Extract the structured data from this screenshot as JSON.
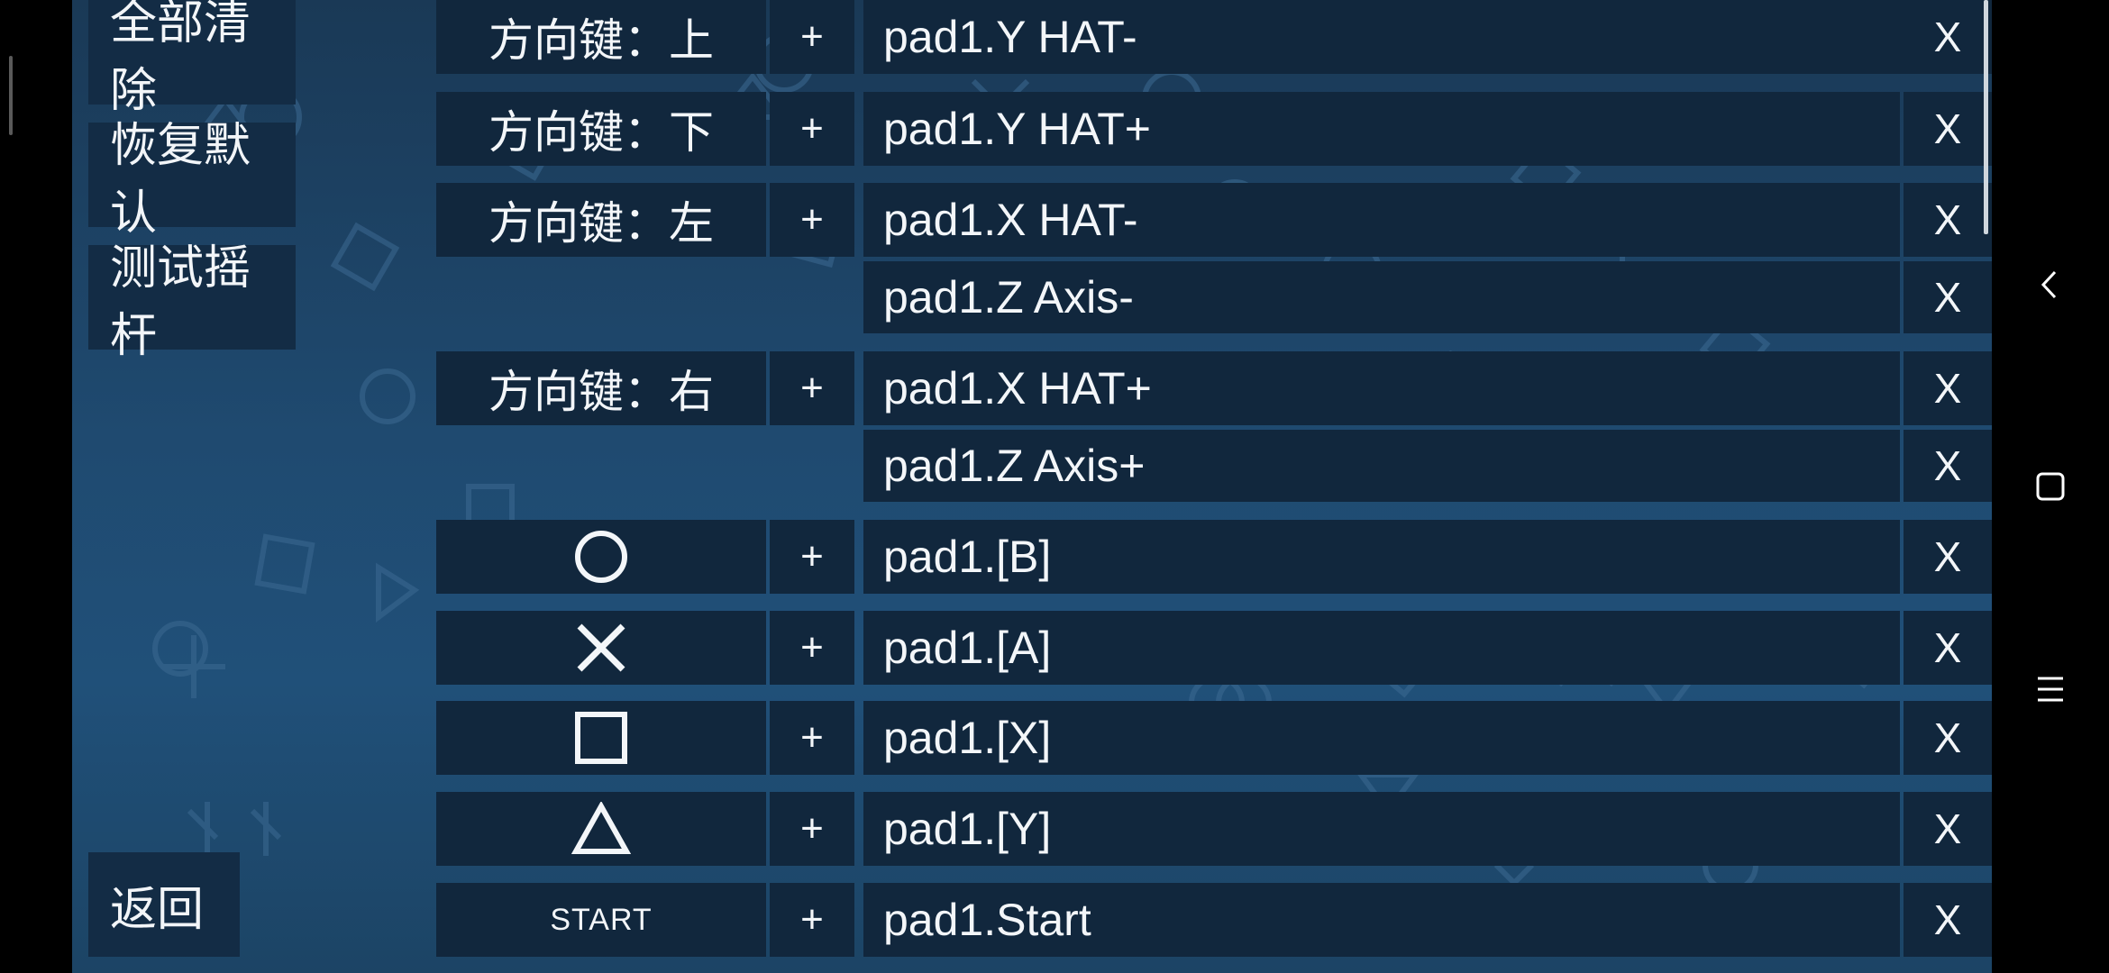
{
  "sidebar": {
    "clear_all": "全部清除",
    "restore_default": "恢复默认",
    "test_joystick": "测试摇杆",
    "back": "返回"
  },
  "mappings": [
    {
      "key": "方向键：上",
      "plus": "+",
      "binding": "pad1.Y HAT-",
      "delete": "X"
    },
    {
      "key": "方向键：下",
      "plus": "+",
      "binding": "pad1.Y HAT+",
      "delete": "X"
    },
    {
      "key": "方向键：左",
      "plus": "+",
      "binding": "pad1.X HAT-",
      "delete": "X"
    },
    {
      "key": "",
      "plus": "",
      "binding": "pad1.Z Axis-",
      "delete": "X"
    },
    {
      "key": "方向键：右",
      "plus": "+",
      "binding": "pad1.X HAT+",
      "delete": "X"
    },
    {
      "key": "",
      "plus": "",
      "binding": "pad1.Z Axis+",
      "delete": "X"
    },
    {
      "key_icon": "circle-icon",
      "plus": "+",
      "binding": "pad1.[B]",
      "delete": "X"
    },
    {
      "key_icon": "cross-icon",
      "plus": "+",
      "binding": "pad1.[A]",
      "delete": "X"
    },
    {
      "key_icon": "square-icon",
      "plus": "+",
      "binding": "pad1.[X]",
      "delete": "X"
    },
    {
      "key_icon": "triangle-icon",
      "plus": "+",
      "binding": "pad1.[Y]",
      "delete": "X"
    },
    {
      "key": "START",
      "plus": "+",
      "binding": "pad1.Start",
      "delete": "X"
    }
  ],
  "nav": {
    "back_icon": "chevron-left-icon",
    "home_icon": "square-icon",
    "menu_icon": "menu-icon"
  },
  "colors": {
    "background_top": "#1a3956",
    "background_bottom": "#205079",
    "cell": "#11273d",
    "button": "#132c45",
    "text": "#f3f6f9"
  }
}
